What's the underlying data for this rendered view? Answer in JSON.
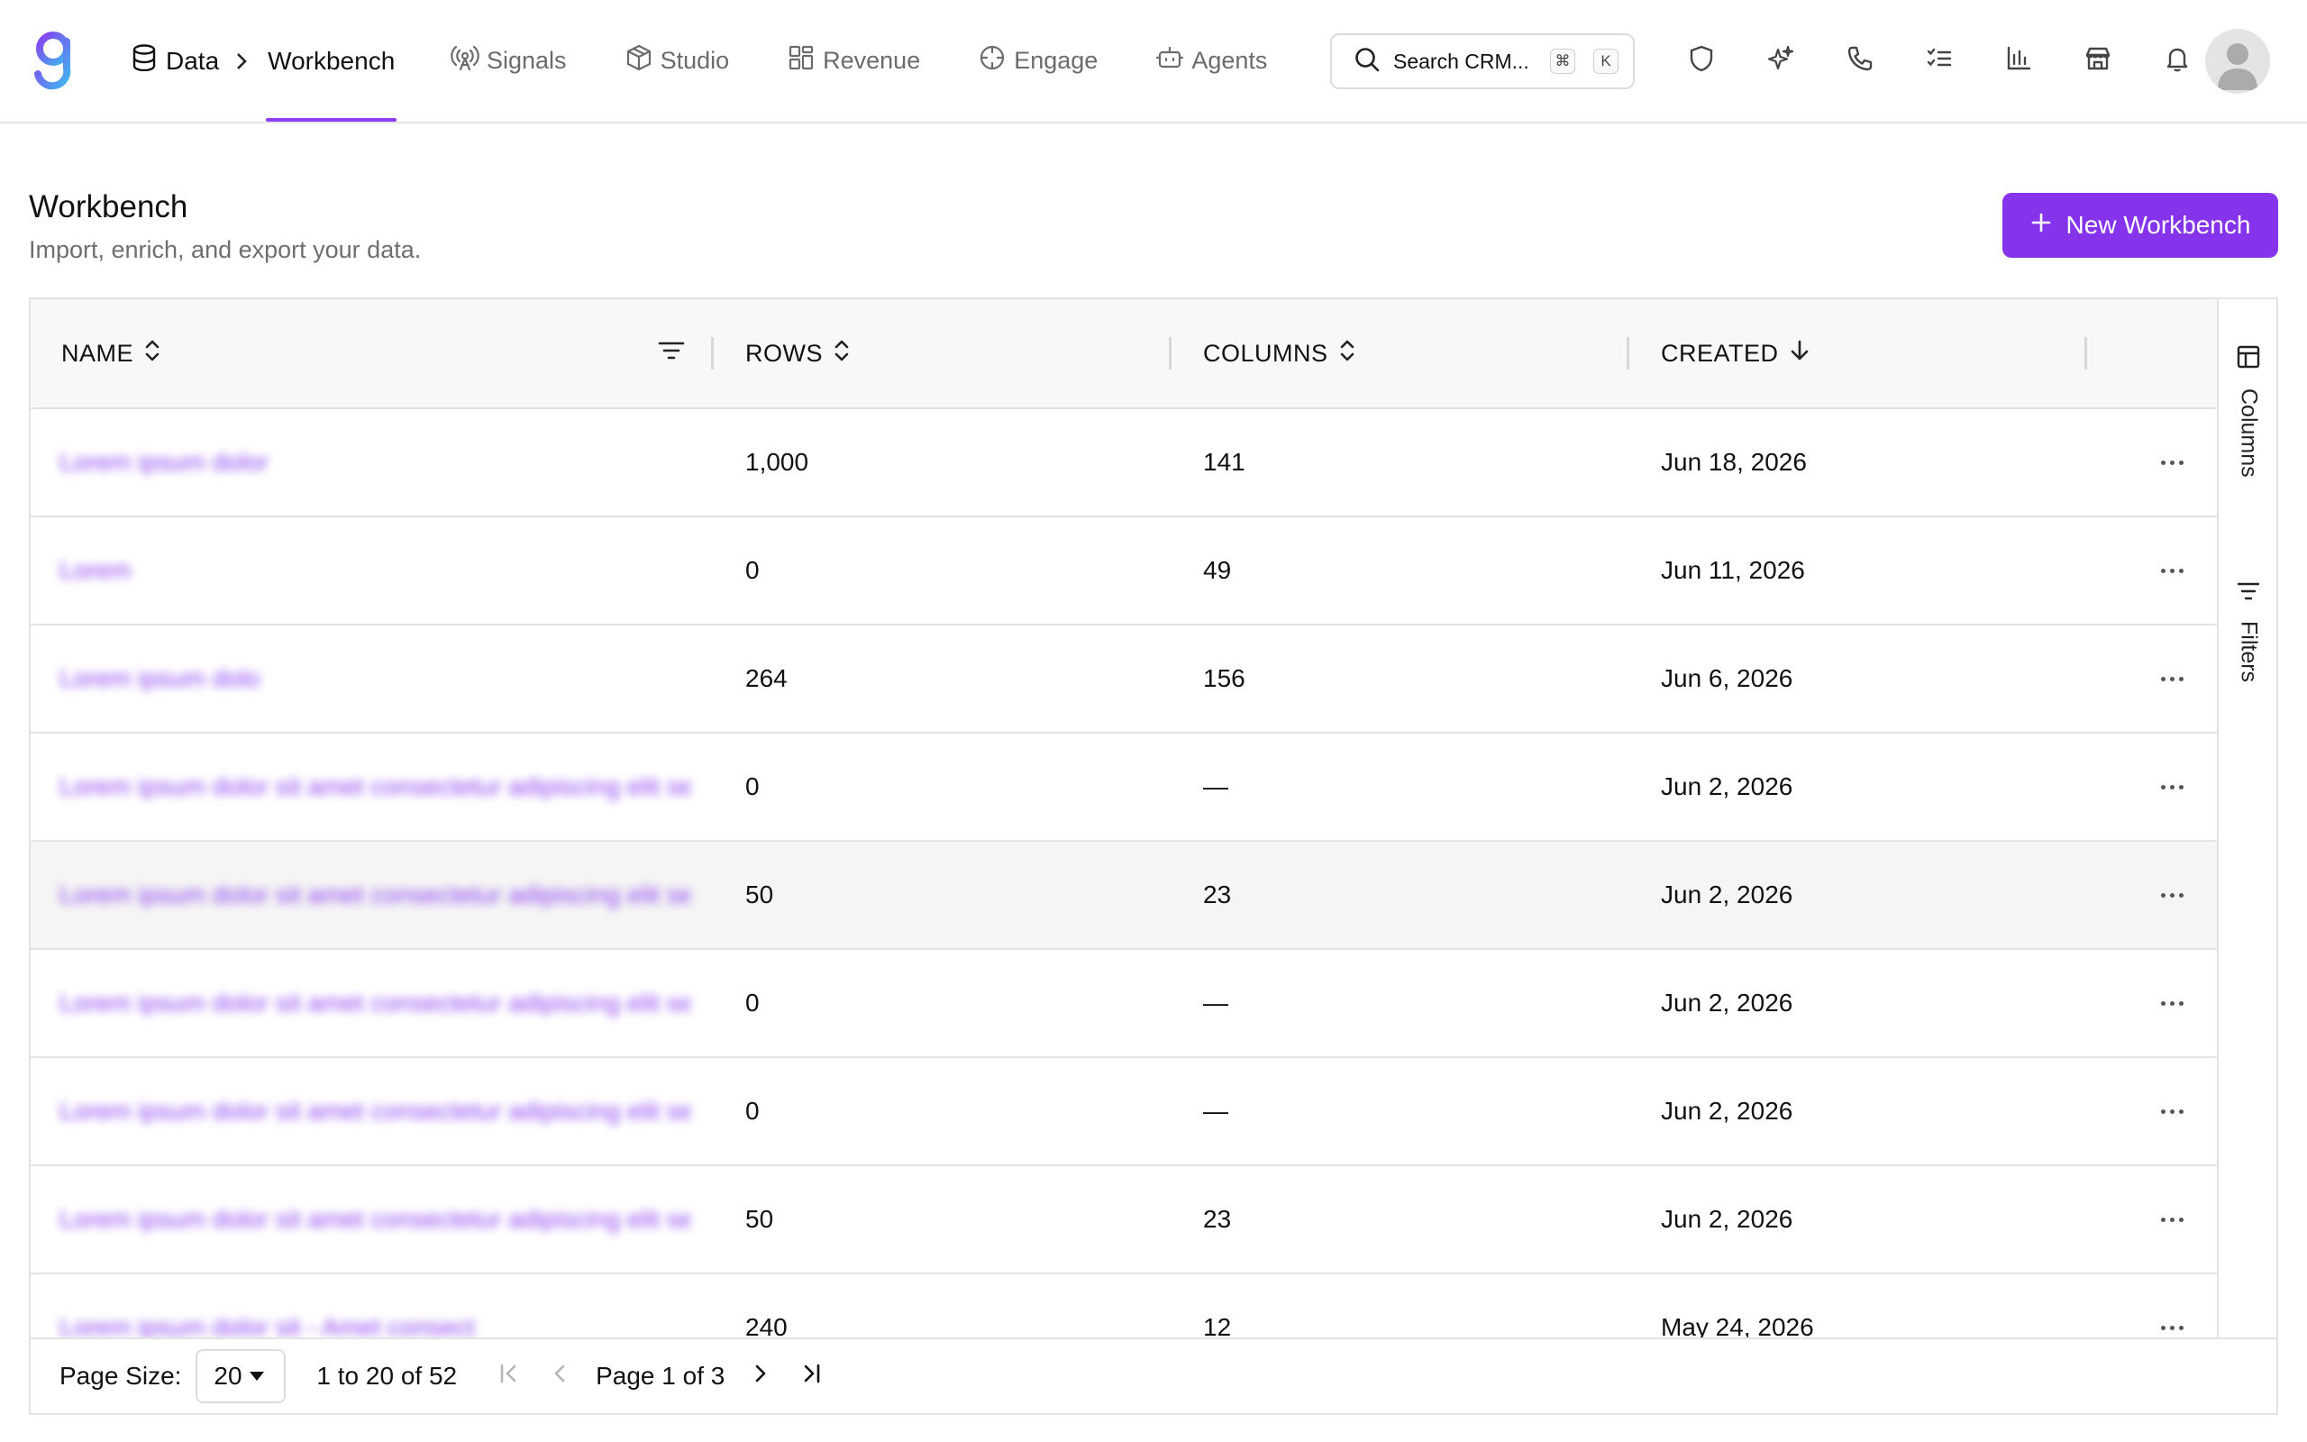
{
  "app": {
    "logo_letter": "g",
    "brand_colors": {
      "primary": "#8634ec",
      "accent": "#3fb6f0"
    }
  },
  "breadcrumb": {
    "root_label": "Data",
    "current_label": "Workbench"
  },
  "nav": [
    {
      "label": "Signals",
      "icon": "radio-signal-icon"
    },
    {
      "label": "Studio",
      "icon": "cube-icon"
    },
    {
      "label": "Revenue",
      "icon": "grid-layout-icon"
    },
    {
      "label": "Engage",
      "icon": "crosshair-icon"
    },
    {
      "label": "Agents",
      "icon": "bot-icon"
    }
  ],
  "search": {
    "placeholder": "Search CRM...",
    "shortcut_mod": "⌘",
    "shortcut_key": "K"
  },
  "toolbar_icons": [
    "shield-icon",
    "sparkles-icon",
    "phone-icon",
    "tasks-icon",
    "bar-chart-icon",
    "store-icon",
    "bell-icon"
  ],
  "page": {
    "title": "Workbench",
    "subtitle": "Import, enrich, and export your data.",
    "new_button_label": "New Workbench"
  },
  "table": {
    "columns": {
      "name": "NAME",
      "rows": "ROWS",
      "columns": "COLUMNS",
      "created": "CREATED"
    },
    "rows": [
      {
        "name": "Lorem ipsum dolor",
        "rows": "1,000",
        "columns": "141",
        "created": "Jun 18, 2026"
      },
      {
        "name": "Lorem",
        "rows": "0",
        "columns": "49",
        "created": "Jun 11, 2026"
      },
      {
        "name": "Lorem ipsum dolo",
        "rows": "264",
        "columns": "156",
        "created": "Jun 6, 2026"
      },
      {
        "name": "Lorem ipsum dolor sit amet consectetur adipiscing elit sed",
        "rows": "0",
        "columns": "—",
        "created": "Jun 2, 2026"
      },
      {
        "name": "Lorem ipsum dolor sit amet consectetur adipiscing elit sed",
        "rows": "50",
        "columns": "23",
        "created": "Jun 2, 2026"
      },
      {
        "name": "Lorem ipsum dolor sit amet consectetur adipiscing elit sed",
        "rows": "0",
        "columns": "—",
        "created": "Jun 2, 2026"
      },
      {
        "name": "Lorem ipsum dolor sit amet consectetur adipiscing elit sed",
        "rows": "0",
        "columns": "—",
        "created": "Jun 2, 2026"
      },
      {
        "name": "Lorem ipsum dolor sit amet consectetur adipiscing elit sed",
        "rows": "50",
        "columns": "23",
        "created": "Jun 2, 2026"
      },
      {
        "name": "Lorem ipsum dolor sit - Amet consect",
        "rows": "240",
        "columns": "12",
        "created": "May 24, 2026"
      }
    ]
  },
  "side_panel": {
    "columns_label": "Columns",
    "filters_label": "Filters"
  },
  "pagination": {
    "page_size_label": "Page Size:",
    "page_size_value": "20",
    "range_text": "1 to 20 of 52",
    "page_text": "Page 1 of 3"
  }
}
